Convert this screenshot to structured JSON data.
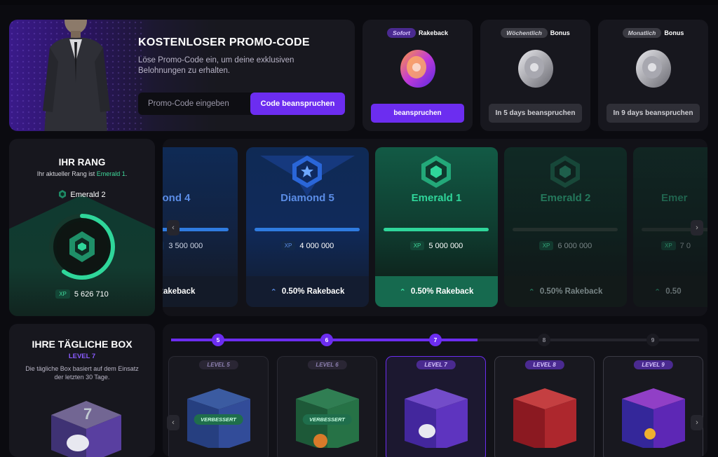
{
  "promo": {
    "title": "KOSTENLOSER PROMO-CODE",
    "description": "Löse Promo-Code ein, um deine exklusiven Belohnungen zu erhalten.",
    "placeholder": "Promo-Code eingeben",
    "button": "Code beanspruchen"
  },
  "rewards": [
    {
      "tag": "Sofort",
      "label": "Rakeback",
      "button": "beanspruchen",
      "active": true
    },
    {
      "tag": "Wöchentlich",
      "label": "Bonus",
      "button": "In 5 days beanspruchen",
      "active": false
    },
    {
      "tag": "Monatlich",
      "label": "Bonus",
      "button": "In 9 days beanspruchen",
      "active": false
    }
  ],
  "rank": {
    "title": "IHR RANG",
    "subtitle_prefix": "Ihr aktueller Rang ist ",
    "subtitle_rank": "Emerald 1",
    "subtitle_suffix": ".",
    "current": "Emerald 2",
    "xp_label": "XP",
    "xp_value": "5 626 710",
    "progress": 0.6
  },
  "tiers": [
    {
      "name": "ond 4",
      "xp": "3 500 000",
      "rakeback": "Rakeback",
      "color": "#2f7be0",
      "state": "past"
    },
    {
      "name": "Diamond 5",
      "xp": "4 000 000",
      "rakeback": "0.50% Rakeback",
      "color": "#2f7be0",
      "state": "past"
    },
    {
      "name": "Emerald 1",
      "xp": "5 000 000",
      "rakeback": "0.50% Rakeback",
      "color": "#2fd69a",
      "state": "current"
    },
    {
      "name": "Emerald 2",
      "xp": "6 000 000",
      "rakeback": "0.50% Rakeback",
      "color": "#2fd69a",
      "state": "future"
    },
    {
      "name": "Emer",
      "xp": "7 0",
      "rakeback": "0.50",
      "color": "#2fd69a",
      "state": "future"
    }
  ],
  "tiers_xp_label": "XP",
  "daily": {
    "title": "IHRE TÄGLICHE BOX",
    "level": "LEVEL 7",
    "description": "Die tägliche Box basiert auf dem Einsatz der letzten 30 Tage."
  },
  "levels": {
    "progress": 0.58,
    "nodes": [
      "5",
      "6",
      "7",
      "8",
      "9"
    ],
    "cards": [
      {
        "label": "LEVEL 5",
        "badge": "VERBESSERT",
        "box_color": "#3a66c8"
      },
      {
        "label": "LEVEL 6",
        "badge": "VERBESSERT",
        "box_color": "#2f9a5a"
      },
      {
        "label": "LEVEL 7",
        "badge": "",
        "box_color": "#6a3ae0"
      },
      {
        "label": "LEVEL 8",
        "badge": "",
        "box_color": "#e0303a"
      },
      {
        "label": "LEVEL 9",
        "badge": "",
        "box_color": "#7a3ae8"
      }
    ]
  }
}
